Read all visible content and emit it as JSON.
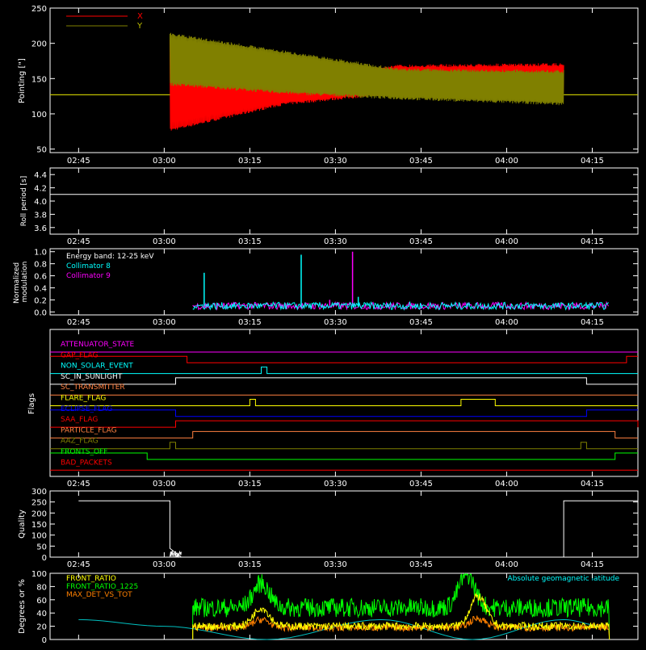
{
  "time_axis": {
    "tick_labels": [
      "02:45",
      "03:00",
      "03:15",
      "03:30",
      "03:45",
      "04:00",
      "04:15"
    ]
  },
  "chart_data": [
    {
      "id": "pointing",
      "type": "line",
      "ylabel": "Pointing [\"]",
      "ylim": [
        45,
        250
      ],
      "yticks": [
        50,
        100,
        150,
        200,
        250
      ],
      "legend_position": "top-left",
      "series": [
        {
          "name": "X",
          "color": "#ff0000",
          "baseline": 127,
          "oscillation_start": "03:01",
          "oscillation_end": "04:10",
          "envelope": [
            [
              0,
              75,
              205
            ],
            [
              20,
              112,
              150
            ],
            [
              40,
              128,
              170
            ],
            [
              69,
              128,
              172
            ]
          ]
        },
        {
          "name": "Y",
          "color": "#808000",
          "baseline": 127,
          "oscillation_start": "03:01",
          "oscillation_end": "04:10",
          "envelope": [
            [
              0,
              140,
              215
            ],
            [
              20,
              128,
              190
            ],
            [
              40,
              120,
              165
            ],
            [
              69,
              112,
              162
            ]
          ]
        }
      ]
    },
    {
      "id": "roll-period",
      "type": "line",
      "ylabel": "Roll period [s]",
      "ylim": [
        3.5,
        4.5
      ],
      "yticks": [
        3.6,
        3.8,
        4.0,
        4.2,
        4.4
      ],
      "series": [
        {
          "color": "#ffffff",
          "value": 4.1
        }
      ]
    },
    {
      "id": "modulation",
      "type": "line",
      "ylabel": "Normalized modulation",
      "ylim": [
        -0.05,
        1.05
      ],
      "yticks": [
        0.0,
        0.2,
        0.4,
        0.6,
        0.8,
        1.0
      ],
      "annotations": [
        "Energy band: 12-25 keV"
      ],
      "series": [
        {
          "name": "Collimator 8",
          "color": "#00ffff",
          "typical": 0.1,
          "spikes": [
            [
              "03:07",
              0.65
            ],
            [
              "03:24",
              0.95
            ],
            [
              "03:34",
              0.25
            ]
          ]
        },
        {
          "name": "Collimator 9",
          "color": "#ff00ff",
          "typical": 0.1,
          "spikes": [
            [
              "03:33",
              1.0
            ],
            [
              "03:29",
              0.2
            ]
          ]
        }
      ]
    },
    {
      "id": "flags",
      "type": "line",
      "ylabel": "Flags",
      "series": [
        {
          "name": "ATTENUATOR_STATE",
          "color": "#ff00ff",
          "steps": []
        },
        {
          "name": "GAP_FLAG",
          "color": "#ff0000",
          "steps": [
            [
              "02:45",
              1
            ],
            [
              "03:04",
              0
            ],
            [
              "04:21",
              1
            ]
          ]
        },
        {
          "name": "NON_SOLAR_EVENT",
          "color": "#00ffff",
          "steps": [
            [
              "02:45",
              0
            ],
            [
              "03:17",
              1
            ],
            [
              "03:18",
              0
            ]
          ]
        },
        {
          "name": "SC_IN_SUNLIGHT",
          "color": "#ffffff",
          "steps": [
            [
              "02:45",
              0
            ],
            [
              "03:02",
              1
            ],
            [
              "04:14",
              0
            ]
          ]
        },
        {
          "name": "SC_TRANSMITTER",
          "color": "#ff8040",
          "steps": []
        },
        {
          "name": "FLARE_FLAG",
          "color": "#ffff00",
          "steps": [
            [
              "02:45",
              0
            ],
            [
              "03:15",
              1
            ],
            [
              "03:16",
              0
            ],
            [
              "03:52",
              1
            ],
            [
              "03:58",
              0
            ]
          ]
        },
        {
          "name": "ECLIPSE_FLAG",
          "color": "#0000ff",
          "steps": [
            [
              "02:45",
              1
            ],
            [
              "03:02",
              0
            ],
            [
              "04:14",
              1
            ]
          ]
        },
        {
          "name": "SAA_FLAG",
          "color": "#ff0000",
          "steps": [
            [
              "02:45",
              0
            ],
            [
              "03:02",
              1
            ],
            [
              "04:23",
              0
            ]
          ]
        },
        {
          "name": "PARTICLE_FLAG",
          "color": "#ff8040",
          "steps": [
            [
              "02:45",
              0
            ],
            [
              "03:05",
              1
            ],
            [
              "04:19",
              0
            ]
          ]
        },
        {
          "name": "AAZ_FLAG",
          "color": "#808000",
          "steps": [
            [
              "02:45",
              0
            ],
            [
              "03:01",
              1
            ],
            [
              "03:02",
              0
            ],
            [
              "04:13",
              1
            ],
            [
              "04:14",
              0
            ]
          ]
        },
        {
          "name": "FRONTS_OFF",
          "color": "#00ff00",
          "steps": [
            [
              "02:45",
              1
            ],
            [
              "02:57",
              0
            ],
            [
              "04:19",
              1
            ]
          ]
        },
        {
          "name": "BAD_PACKETS",
          "color": "#ff0000",
          "steps": []
        }
      ]
    },
    {
      "id": "quality",
      "type": "line",
      "ylabel": "Quality",
      "ylim": [
        0,
        300
      ],
      "yticks": [
        0,
        50,
        100,
        150,
        200,
        250,
        300
      ],
      "series": [
        {
          "color": "#ffffff",
          "segments": [
            [
              "02:45",
              255
            ],
            [
              "03:01",
              255
            ],
            [
              "03:01",
              40
            ],
            [
              "03:03",
              0
            ],
            [
              "04:10",
              0
            ],
            [
              "04:10",
              255
            ],
            [
              "04:23",
              255
            ]
          ]
        }
      ]
    },
    {
      "id": "front-ratio",
      "type": "line",
      "ylabel": "Degrees or %",
      "ylim": [
        0,
        100
      ],
      "yticks": [
        0,
        20,
        40,
        60,
        80,
        100
      ],
      "annotations": [
        "Absolute geomagnetic latitude"
      ],
      "series": [
        {
          "name": "FRONT_RATIO",
          "color": "#ffff00",
          "typical": 20,
          "peaks": [
            [
              "03:17",
              48
            ],
            [
              "03:55",
              65
            ]
          ]
        },
        {
          "name": "FRONT_RATIO_1225",
          "color": "#00ff00",
          "typical": 48,
          "peaks": [
            [
              "03:17",
              85
            ],
            [
              "03:53",
              98
            ]
          ]
        },
        {
          "name": "MAX_DET_VS_TOT",
          "color": "#ff8000",
          "typical": 18,
          "peaks": [
            [
              "03:17",
              30
            ],
            [
              "03:55",
              32
            ]
          ]
        },
        {
          "name": "Absolute geomagnetic latitude",
          "color": "#00c0c0",
          "points": [
            [
              "02:45",
              30
            ],
            [
              "03:00",
              20
            ],
            [
              "03:18",
              0
            ],
            [
              "03:38",
              30
            ],
            [
              "03:54",
              0
            ],
            [
              "04:10",
              30
            ],
            [
              "04:17",
              20
            ]
          ]
        }
      ]
    }
  ]
}
